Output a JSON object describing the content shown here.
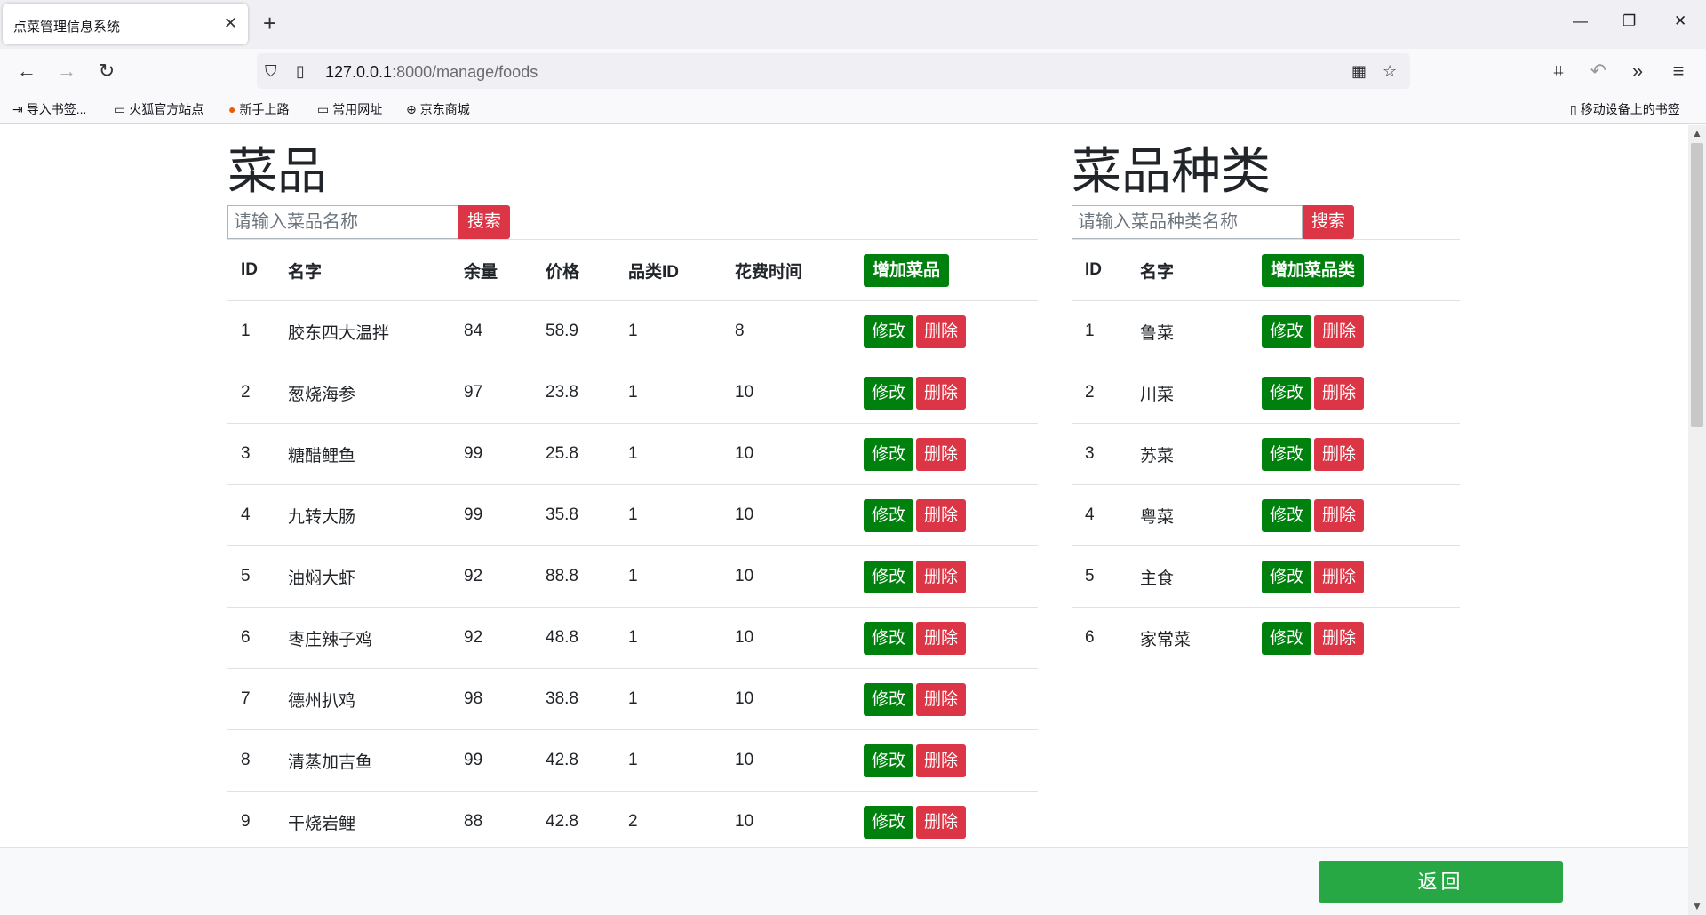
{
  "browser": {
    "tab_title": "点菜管理信息系统",
    "url_host": "127.0.0.1",
    "url_rest": ":8000/manage/foods",
    "bookmarks": [
      "导入书签...",
      "火狐官方站点",
      "新手上路",
      "常用网址",
      "京东商城"
    ],
    "mobile_bookmarks": "移动设备上的书签"
  },
  "foods": {
    "title": "菜品",
    "search_placeholder": "请输入菜品名称",
    "search_label": "搜索",
    "add_label": "增加菜品",
    "columns": [
      "ID",
      "名字",
      "余量",
      "价格",
      "品类ID",
      "花费时间"
    ],
    "rows": [
      [
        "1",
        "胶东四大温拌",
        "84",
        "58.9",
        "1",
        "8"
      ],
      [
        "2",
        "葱烧海参",
        "97",
        "23.8",
        "1",
        "10"
      ],
      [
        "3",
        "糖醋鲤鱼",
        "99",
        "25.8",
        "1",
        "10"
      ],
      [
        "4",
        "九转大肠",
        "99",
        "35.8",
        "1",
        "10"
      ],
      [
        "5",
        "油焖大虾",
        "92",
        "88.8",
        "1",
        "10"
      ],
      [
        "6",
        "枣庄辣子鸡",
        "92",
        "48.8",
        "1",
        "10"
      ],
      [
        "7",
        "德州扒鸡",
        "98",
        "38.8",
        "1",
        "10"
      ],
      [
        "8",
        "清蒸加吉鱼",
        "99",
        "42.8",
        "1",
        "10"
      ],
      [
        "9",
        "干烧岩鲤",
        "88",
        "42.8",
        "2",
        "10"
      ]
    ],
    "edit_label": "修改",
    "delete_label": "删除"
  },
  "categories": {
    "title": "菜品种类",
    "search_placeholder": "请输入菜品种类名称",
    "search_label": "搜索",
    "add_label": "增加菜品类",
    "columns": [
      "ID",
      "名字"
    ],
    "rows": [
      [
        "1",
        "鲁菜"
      ],
      [
        "2",
        "川菜"
      ],
      [
        "3",
        "苏菜"
      ],
      [
        "4",
        "粤菜"
      ],
      [
        "5",
        "主食"
      ],
      [
        "6",
        "家常菜"
      ]
    ],
    "edit_label": "修改",
    "delete_label": "删除"
  },
  "footer": {
    "back_label": "返回"
  },
  "colors": {
    "green": "#00800d",
    "red": "#dc3545",
    "back_green": "#28a745"
  }
}
